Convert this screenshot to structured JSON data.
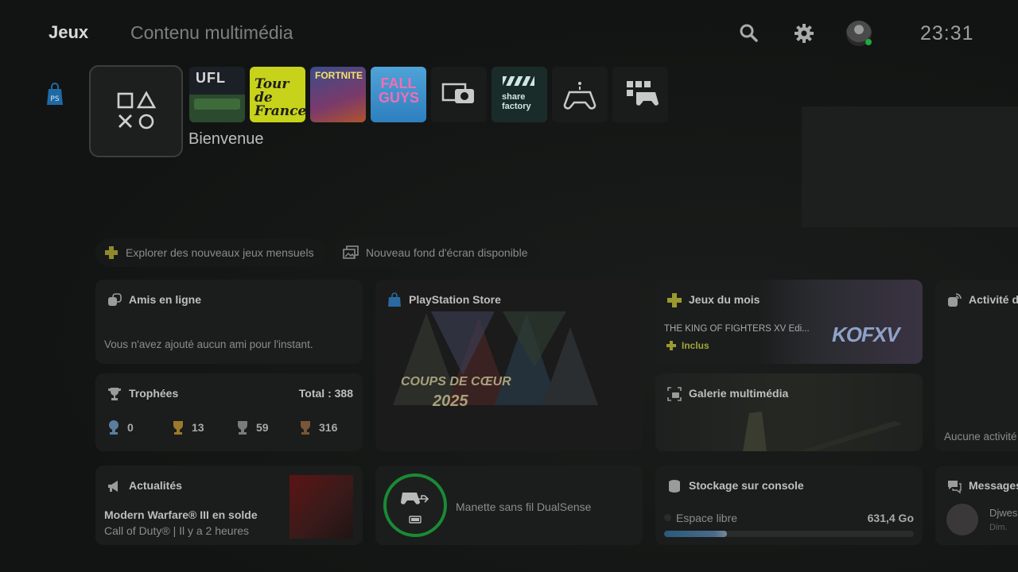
{
  "header": {
    "tab_games": "Jeux",
    "tab_media": "Contenu multimédia",
    "clock": "23:31",
    "icons": [
      "search-icon",
      "gear-icon",
      "profile-avatar"
    ]
  },
  "launcher": {
    "welcome_label": "Bienvenue",
    "tiles": [
      {
        "name": "UFL",
        "text": "UFL"
      },
      {
        "name": "Tour de France 2025",
        "text": "Tour de France"
      },
      {
        "name": "Fortnite",
        "text": "FORTNITE"
      },
      {
        "name": "Fall Guys",
        "text": "FALL GUYS"
      },
      {
        "name": "Media capture",
        "icon": "camera-icon"
      },
      {
        "name": "Share Factory",
        "text": "share factory"
      },
      {
        "name": "Game base",
        "icon": "controller-icon"
      },
      {
        "name": "Game library",
        "icon": "library-icon"
      }
    ]
  },
  "pills": {
    "monthly_games": "Explorer des nouveaux jeux mensuels",
    "wallpaper": "Nouveau fond d'écran disponible"
  },
  "cards": {
    "friends": {
      "title": "Amis en ligne",
      "message": "Vous n'avez ajouté aucun ami pour l'instant."
    },
    "trophies": {
      "title": "Trophées",
      "total": "Total : 388",
      "counts": [
        {
          "type": "platinum",
          "value": "0"
        },
        {
          "type": "gold",
          "value": "13"
        },
        {
          "type": "silver",
          "value": "59"
        },
        {
          "type": "bronze",
          "value": "316"
        }
      ]
    },
    "store": {
      "title": "PlayStation Store",
      "banner_line1": "COUPS DE CŒUR",
      "banner_line2": "2025"
    },
    "monthly": {
      "title": "Jeux du mois",
      "game": "THE KING OF FIGHTERS XV Edi...",
      "badge": "Inclus",
      "logo_text": "KOFXV"
    },
    "gallery": {
      "title": "Galerie multimédia"
    },
    "activity": {
      "title": "Activité de",
      "empty": "Aucune activité"
    },
    "news": {
      "title": "Actualités",
      "headline": "Modern Warfare® III en solde",
      "subline": "Call of Duty® | Il y a 2 heures"
    },
    "controller": {
      "name": "Manette sans fil DualSense"
    },
    "storage": {
      "title": "Stockage sur console",
      "free_label": "Espace libre",
      "free_value": "631,4 Go",
      "used_fraction": 0.25
    },
    "messages": {
      "title": "Messages",
      "sender": "Djwes",
      "when": "Dim."
    }
  },
  "colors": {
    "accent_green": "#1faa3a",
    "plus_yellow": "#a1a63a",
    "background": "#121413"
  }
}
